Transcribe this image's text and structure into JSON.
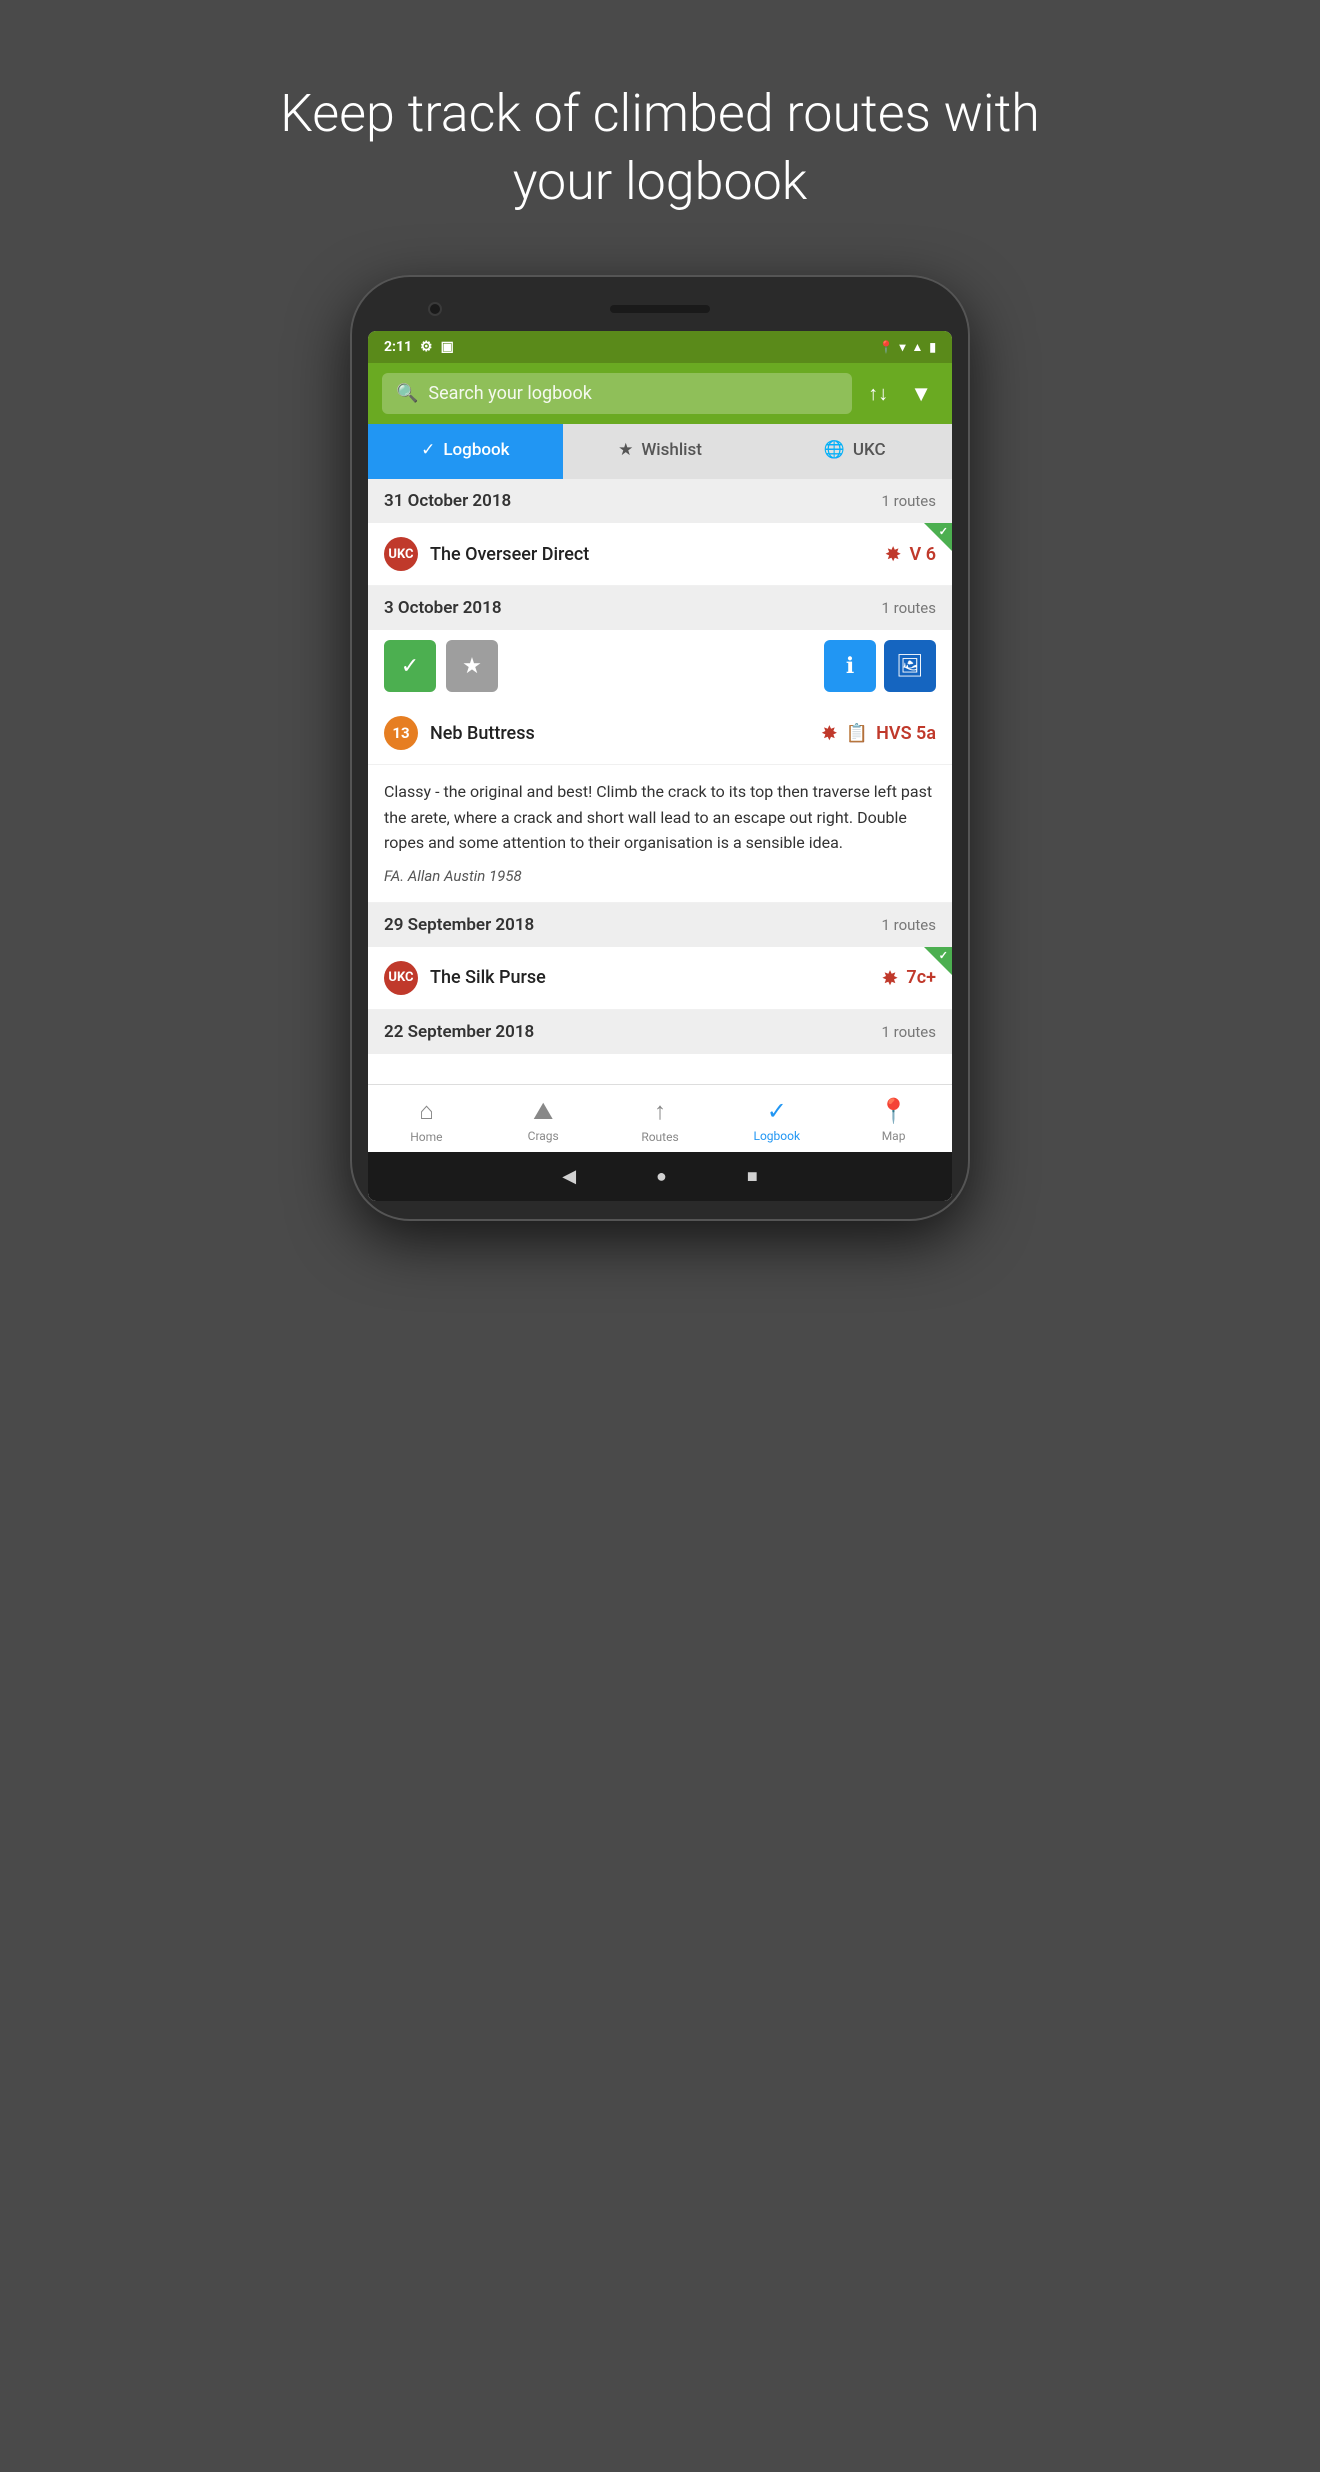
{
  "page": {
    "hero_title": "Keep track of climbed routes with your logbook"
  },
  "status_bar": {
    "time": "2:11",
    "icons_left": [
      "gear",
      "sim"
    ],
    "icons_right": [
      "location",
      "wifi",
      "signal",
      "battery"
    ]
  },
  "search": {
    "placeholder": "Search your logbook",
    "sort_label": "↑↓",
    "filter_label": "▼"
  },
  "tabs": [
    {
      "id": "logbook",
      "label": "Logbook",
      "icon": "✓",
      "active": true
    },
    {
      "id": "wishlist",
      "label": "Wishlist",
      "icon": "★",
      "active": false
    },
    {
      "id": "ukc",
      "label": "UKC",
      "icon": "🌐",
      "active": false
    }
  ],
  "log_entries": [
    {
      "date": "31 October 2018",
      "routes_count": "1 routes",
      "routes": [
        {
          "name": "The Overseer Direct",
          "badge_text": "UKC",
          "badge_class": "badge-ukc",
          "grade": "V 6",
          "has_green_corner": true,
          "has_action_row": false
        }
      ]
    },
    {
      "date": "3 October 2018",
      "routes_count": "1 routes",
      "routes": [
        {
          "name": "Neb Buttress",
          "badge_text": "13",
          "badge_class": "badge-orange",
          "grade": "HVS 5a",
          "has_green_corner": false,
          "has_action_row": true,
          "description": "Classy - the original and best! Climb the crack to its top then traverse left past the arete, where a crack and short wall lead to an escape out right. Double ropes and some attention to their organisation is a sensible idea.",
          "fa": "FA. Allan Austin 1958"
        }
      ]
    },
    {
      "date": "29 September 2018",
      "routes_count": "1 routes",
      "routes": [
        {
          "name": "The Silk Purse",
          "badge_text": "UKC",
          "badge_class": "badge-ukc",
          "grade": "7c+",
          "has_green_corner": true,
          "has_action_row": false
        }
      ]
    },
    {
      "date": "22 September 2018",
      "routes_count": "1 routes",
      "routes": []
    }
  ],
  "bottom_nav": [
    {
      "id": "home",
      "label": "Home",
      "icon": "⌂",
      "active": false
    },
    {
      "id": "crags",
      "label": "Crags",
      "icon": "⛰",
      "active": false
    },
    {
      "id": "routes",
      "label": "Routes",
      "icon": "↑",
      "active": false
    },
    {
      "id": "logbook",
      "label": "Logbook",
      "icon": "✓",
      "active": true
    },
    {
      "id": "map",
      "label": "Map",
      "icon": "📍",
      "active": false
    }
  ],
  "android_nav": {
    "back": "◀",
    "home": "●",
    "recents": "■"
  }
}
